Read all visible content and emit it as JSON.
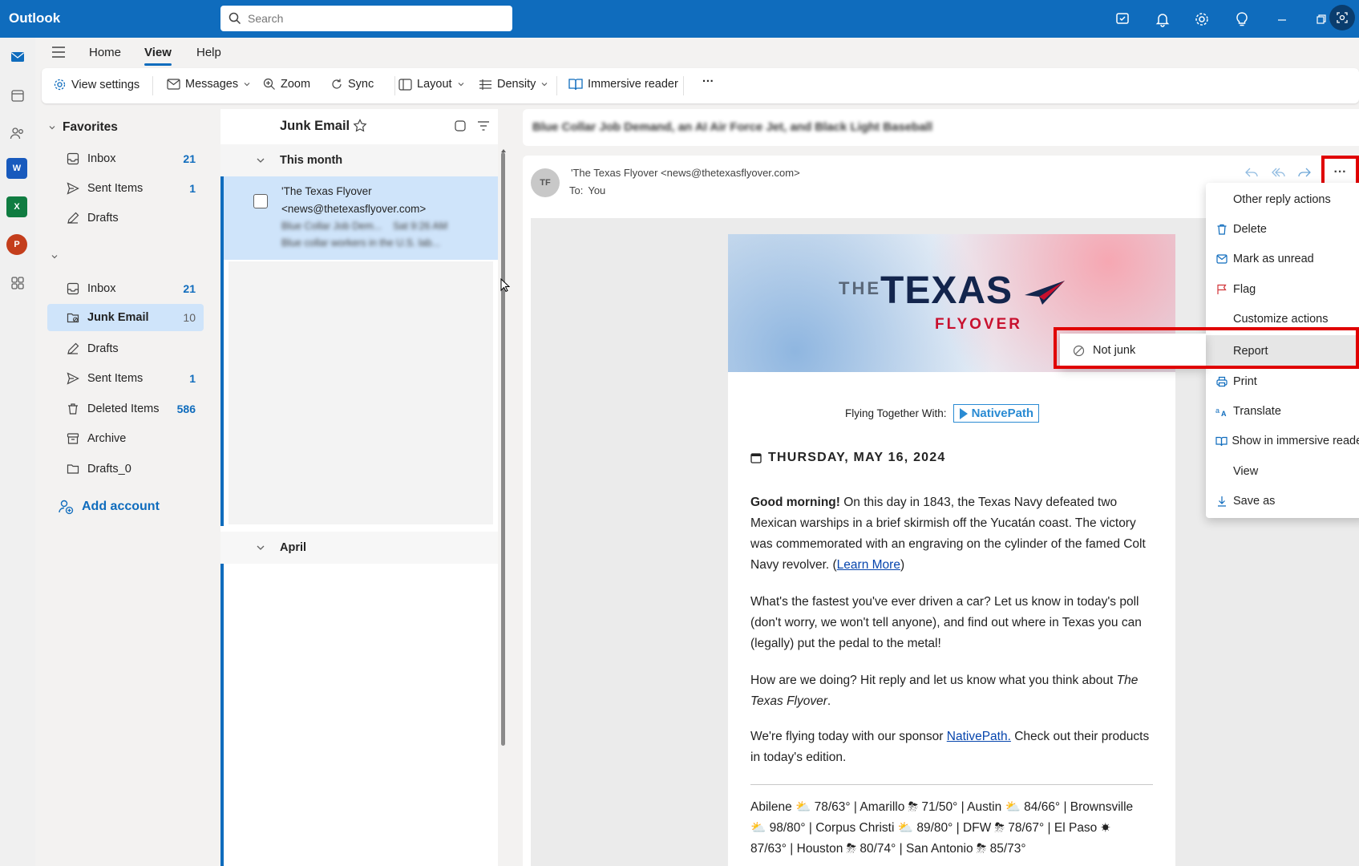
{
  "app": {
    "name": "Outlook"
  },
  "search": {
    "placeholder": "Search"
  },
  "menu": {
    "tabs": [
      "Home",
      "View",
      "Help"
    ]
  },
  "ribbon": {
    "view_settings": "View settings",
    "messages": "Messages",
    "zoom": "Zoom",
    "sync": "Sync",
    "layout": "Layout",
    "density": "Density",
    "immersive_reader": "Immersive reader",
    "more": "···"
  },
  "folders": {
    "favorites_label": "Favorites",
    "favorites": [
      {
        "name": "Inbox",
        "count": "21"
      },
      {
        "name": "Sent Items",
        "count": "1"
      },
      {
        "name": "Drafts",
        "count": ""
      }
    ],
    "account": [
      {
        "name": "Inbox",
        "count": "21"
      },
      {
        "name": "Junk Email",
        "count": "10"
      },
      {
        "name": "Drafts",
        "count": ""
      },
      {
        "name": "Sent Items",
        "count": "1"
      },
      {
        "name": "Deleted Items",
        "count": "586"
      },
      {
        "name": "Archive",
        "count": ""
      },
      {
        "name": "Drafts_0",
        "count": ""
      }
    ],
    "add_account": "Add account"
  },
  "message_list": {
    "folder_title": "Junk Email",
    "group_this_month": "This month",
    "group_april": "April",
    "selected": {
      "sender_line1": "'The Texas Flyover",
      "sender_line2": "<news@thetexasflyover.com>",
      "subject_preview": "Blue Collar Job Dem...",
      "time": "Sat 9:26 AM",
      "body_preview": "Blue collar workers in the U.S. lab..."
    }
  },
  "reading": {
    "subject": "Blue Collar Job Demand, an AI Air Force Jet, and Black Light Baseball",
    "avatar_initials": "TF",
    "from": "'The Texas Flyover <news@thetexasflyover.com>",
    "to_label": "To:",
    "to_value": "You"
  },
  "newsletter": {
    "logo_the": "THE",
    "logo_texas": "TEXAS",
    "logo_flyover": "FLYOVER",
    "flying_together": "Flying Together With:",
    "sponsor_badge": "NativePath",
    "date": "THURSDAY, MAY 16, 2024",
    "p1_bold": "Good morning!",
    "p1_text": " On this day in 1843, the Texas Navy defeated two Mexican warships in a brief skirmish off the Yucatán coast. The victory was commemorated with an engraving on the cylinder of the famed Colt Navy revolver. (",
    "p1_link": "Learn More",
    "p1_end": ")",
    "p2": "What's the fastest you've ever driven a car? Let us know in today's poll (don't worry, we won't tell anyone), and find out where in Texas you can (legally) put the pedal to the metal!",
    "p3_text": "How are we doing? Hit reply and let us know what you think about ",
    "p3_italic": "The Texas Flyover",
    "p3_end": ".",
    "p4_text": "We're flying today with our sponsor ",
    "p4_link": "NativePath.",
    "p4_end": " Check out their products in today's edition.",
    "weather_line1": "Abilene ⛅ 78/63° | Amarillo ⛈ 71/50° | Austin ⛅ 84/66° | Brownsville",
    "weather_line2": "⛅ 98/80° | Corpus Christi ⛅ 89/80° | DFW ⛈ 78/67° | El Paso ☀",
    "weather_line3": "87/63° | Houston ⛈ 80/74° | San Antonio ⛈ 85/73°"
  },
  "dropdown": {
    "items": [
      {
        "label": "Other reply actions",
        "icon": ""
      },
      {
        "label": "Delete",
        "icon": "trash-icon"
      },
      {
        "label": "Mark as unread",
        "icon": "envelope-icon"
      },
      {
        "label": "Flag",
        "icon": "flag-icon"
      },
      {
        "label": "Customize actions",
        "icon": ""
      },
      {
        "label": "Report",
        "icon": ""
      },
      {
        "label": "Print",
        "icon": "printer-icon"
      },
      {
        "label": "Translate",
        "icon": "translate-icon"
      },
      {
        "label": "Show in immersive reader",
        "icon": "immersive-reader-icon"
      },
      {
        "label": "View",
        "icon": ""
      },
      {
        "label": "Save as",
        "icon": "download-icon"
      }
    ],
    "submenu_not_junk": "Not junk"
  },
  "colors": {
    "brand": "#0f6cbd",
    "highlight": "#e00000",
    "selected_bg": "#cfe4fa"
  }
}
